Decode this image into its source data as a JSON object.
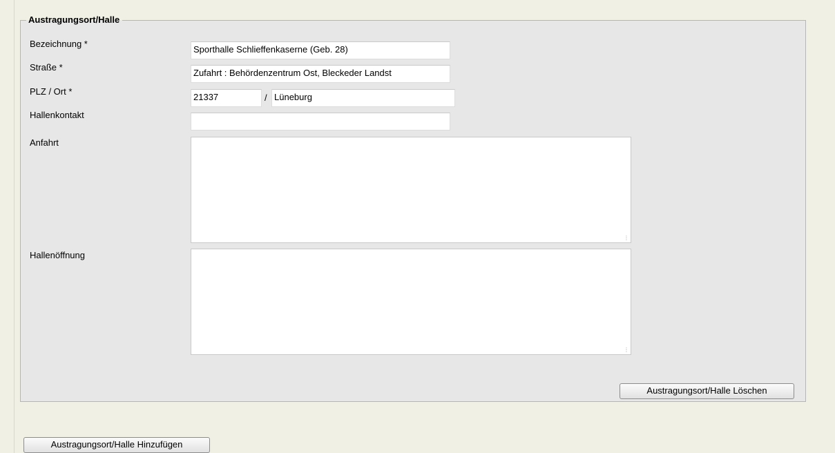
{
  "fieldset": {
    "legend": "Austragungsort/Halle"
  },
  "fields": {
    "bezeichnung": {
      "label": "Bezeichnung *",
      "value": "Sporthalle Schlieffenkaserne (Geb. 28)"
    },
    "strasse": {
      "label": "Straße *",
      "value": "Zufahrt : Behördenzentrum Ost, Bleckeder Landst"
    },
    "plz_ort": {
      "label": "PLZ / Ort *",
      "plz_value": "21337",
      "separator": "/",
      "ort_value": "Lüneburg"
    },
    "hallenkontakt": {
      "label": "Hallenkontakt",
      "value": ""
    },
    "anfahrt": {
      "label": "Anfahrt",
      "value": ""
    },
    "hallenoeffnung": {
      "label": "Hallenöffnung",
      "value": ""
    }
  },
  "buttons": {
    "delete_label": "Austragungsort/Halle Löschen",
    "add_label": "Austragungsort/Halle Hinzufügen"
  },
  "icons": {
    "resize_grip": "resize-grip-icon"
  }
}
